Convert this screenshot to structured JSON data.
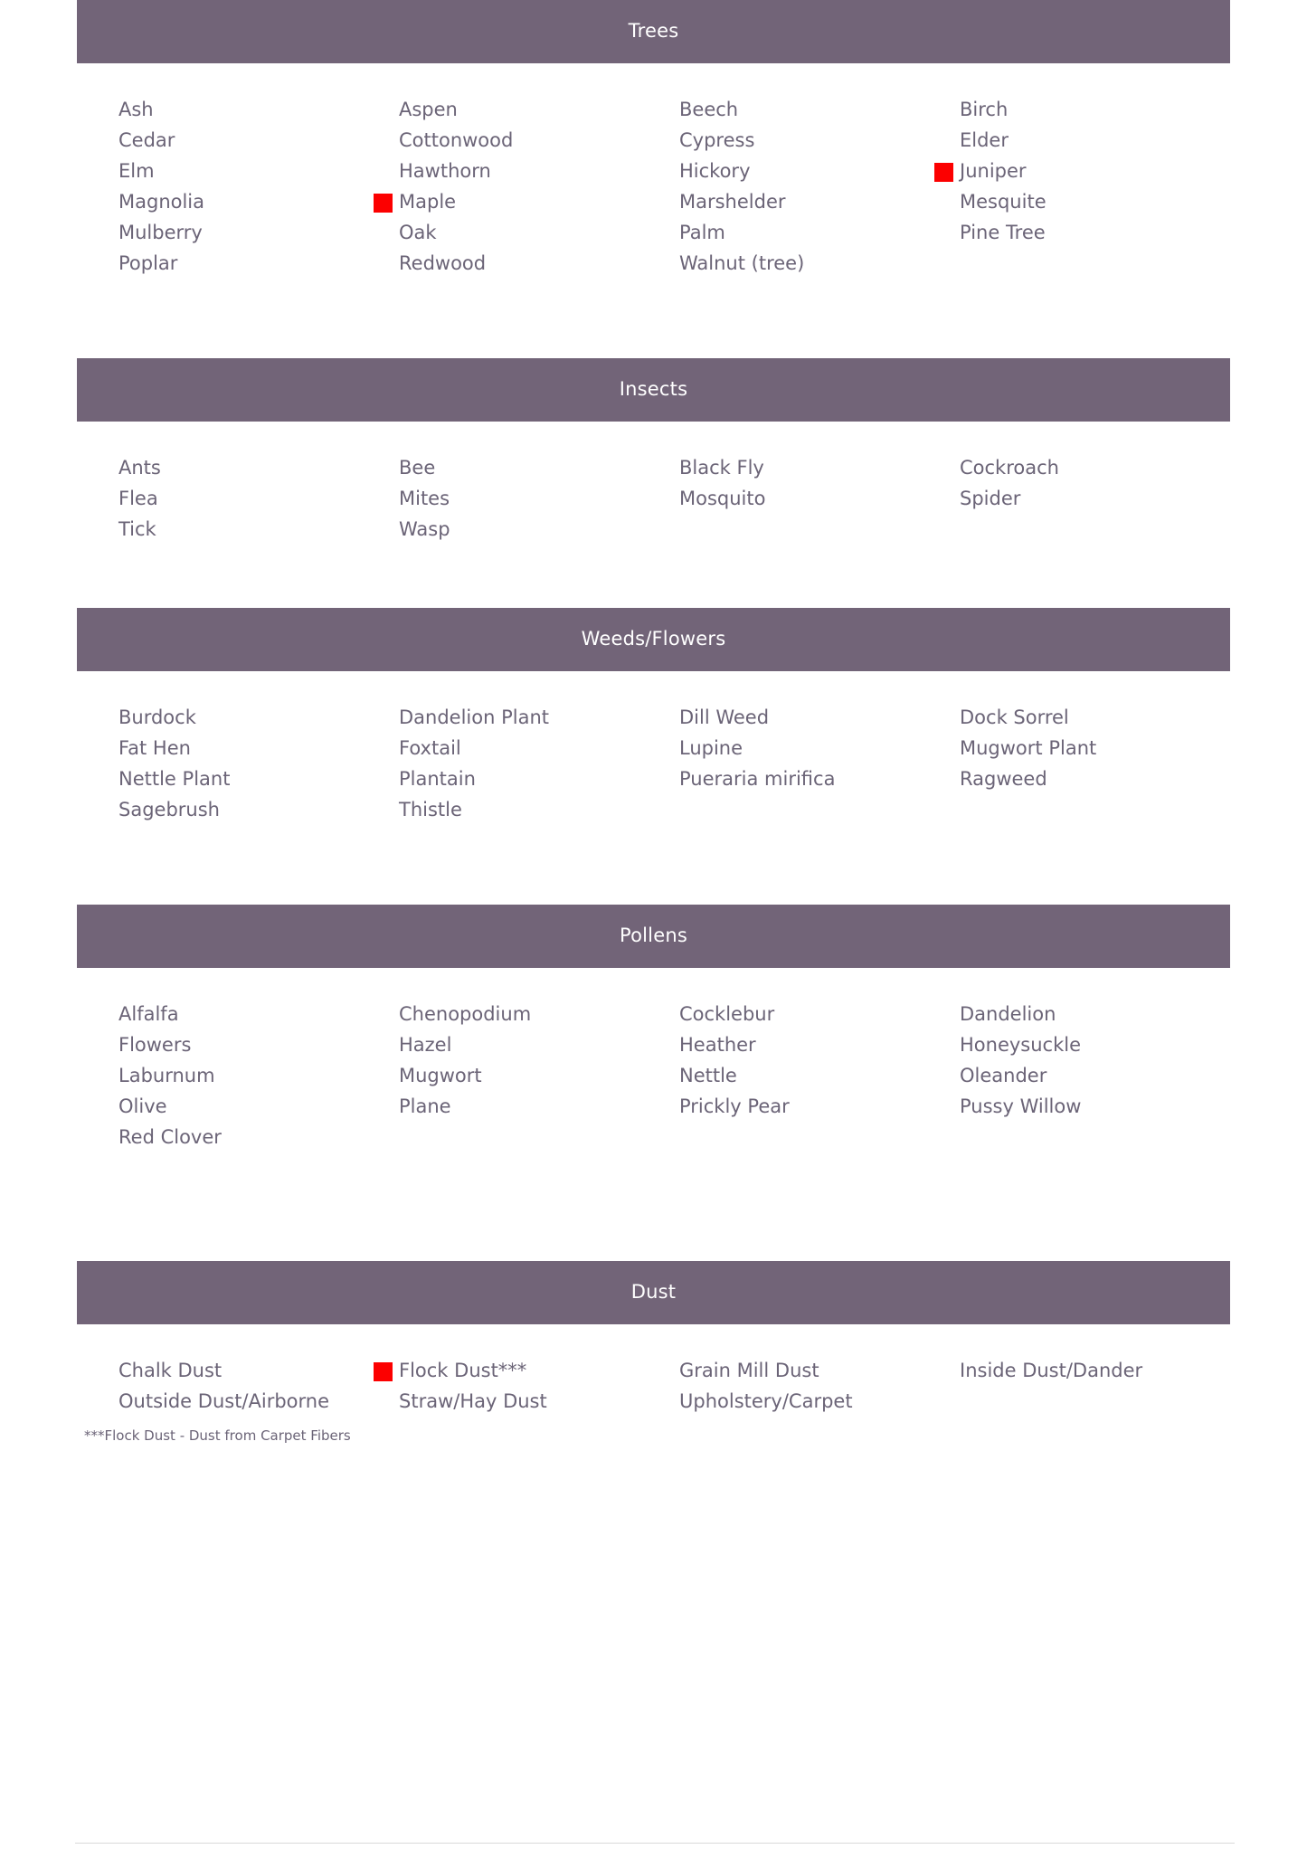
{
  "colors": {
    "header_bg": "#726478",
    "header_text": "#ffffff",
    "item_text": "#6b6477",
    "marker_red": "#fc0000",
    "page_bg": "#ffffff",
    "rule": "#d9d9d9"
  },
  "sections": [
    {
      "title": "Trees",
      "columns": [
        [
          {
            "label": "Ash",
            "marked": false
          },
          {
            "label": "Cedar",
            "marked": false
          },
          {
            "label": "Elm",
            "marked": false
          },
          {
            "label": "Magnolia",
            "marked": false
          },
          {
            "label": "Mulberry",
            "marked": false
          },
          {
            "label": "Poplar",
            "marked": false
          }
        ],
        [
          {
            "label": "Aspen",
            "marked": false
          },
          {
            "label": "Cottonwood",
            "marked": false
          },
          {
            "label": "Hawthorn",
            "marked": false
          },
          {
            "label": "Maple",
            "marked": true
          },
          {
            "label": "Oak",
            "marked": false
          },
          {
            "label": "Redwood",
            "marked": false
          }
        ],
        [
          {
            "label": "Beech",
            "marked": false
          },
          {
            "label": "Cypress",
            "marked": false
          },
          {
            "label": "Hickory",
            "marked": false
          },
          {
            "label": "Marshelder",
            "marked": false
          },
          {
            "label": "Palm",
            "marked": false
          },
          {
            "label": "Walnut (tree)",
            "marked": false
          }
        ],
        [
          {
            "label": "Birch",
            "marked": false
          },
          {
            "label": "Elder",
            "marked": false
          },
          {
            "label": "Juniper",
            "marked": true
          },
          {
            "label": "Mesquite",
            "marked": false
          },
          {
            "label": "Pine Tree",
            "marked": false
          }
        ]
      ],
      "footnote": "",
      "gap_after": "gap-md"
    },
    {
      "title": "Insects",
      "columns": [
        [
          {
            "label": "Ants",
            "marked": false
          },
          {
            "label": "Flea",
            "marked": false
          },
          {
            "label": "Tick",
            "marked": false
          }
        ],
        [
          {
            "label": "Bee",
            "marked": false
          },
          {
            "label": "Mites",
            "marked": false
          },
          {
            "label": "Wasp",
            "marked": false
          }
        ],
        [
          {
            "label": "Black Fly",
            "marked": false
          },
          {
            "label": "Mosquito",
            "marked": false
          }
        ],
        [
          {
            "label": "Cockroach",
            "marked": false
          },
          {
            "label": "Spider",
            "marked": false
          }
        ]
      ],
      "footnote": "",
      "gap_after": "gap-sm"
    },
    {
      "title": "Weeds/Flowers",
      "columns": [
        [
          {
            "label": "Burdock",
            "marked": false
          },
          {
            "label": "Fat Hen",
            "marked": false
          },
          {
            "label": "Nettle Plant",
            "marked": false
          },
          {
            "label": "Sagebrush",
            "marked": false
          }
        ],
        [
          {
            "label": "Dandelion Plant",
            "marked": false
          },
          {
            "label": "Foxtail",
            "marked": false
          },
          {
            "label": "Plantain",
            "marked": false
          },
          {
            "label": "Thistle",
            "marked": false
          }
        ],
        [
          {
            "label": "Dill Weed",
            "marked": false
          },
          {
            "label": "Lupine",
            "marked": false
          },
          {
            "label": "Pueraria mirifica",
            "marked": false
          }
        ],
        [
          {
            "label": "Dock Sorrel",
            "marked": false
          },
          {
            "label": "Mugwort Plant",
            "marked": false
          },
          {
            "label": "Ragweed",
            "marked": false
          }
        ]
      ],
      "footnote": "",
      "gap_after": "gap-md"
    },
    {
      "title": "Pollens",
      "columns": [
        [
          {
            "label": "Alfalfa",
            "marked": false
          },
          {
            "label": "Flowers",
            "marked": false
          },
          {
            "label": "Laburnum",
            "marked": false
          },
          {
            "label": "Olive",
            "marked": false
          },
          {
            "label": "Red Clover",
            "marked": false
          }
        ],
        [
          {
            "label": "Chenopodium",
            "marked": false
          },
          {
            "label": "Hazel",
            "marked": false
          },
          {
            "label": "Mugwort",
            "marked": false
          },
          {
            "label": "Plane",
            "marked": false
          }
        ],
        [
          {
            "label": "Cocklebur",
            "marked": false
          },
          {
            "label": "Heather",
            "marked": false
          },
          {
            "label": "Nettle",
            "marked": false
          },
          {
            "label": "Prickly Pear",
            "marked": false
          }
        ],
        [
          {
            "label": "Dandelion",
            "marked": false
          },
          {
            "label": "Honeysuckle",
            "marked": false
          },
          {
            "label": "Oleander",
            "marked": false
          },
          {
            "label": "Pussy Willow",
            "marked": false
          }
        ]
      ],
      "footnote": "",
      "gap_after": "gap-xl"
    },
    {
      "title": "Dust",
      "columns": [
        [
          {
            "label": "Chalk Dust",
            "marked": false
          },
          {
            "label": "Outside Dust/Airborne",
            "marked": false
          }
        ],
        [
          {
            "label": "Flock Dust***",
            "marked": true
          },
          {
            "label": "Straw/Hay Dust",
            "marked": false
          }
        ],
        [
          {
            "label": "Grain Mill Dust",
            "marked": false
          },
          {
            "label": "Upholstery/Carpet",
            "marked": false
          }
        ],
        [
          {
            "label": "Inside Dust/Dander",
            "marked": false
          }
        ]
      ],
      "footnote": "***Flock Dust - Dust from Carpet Fibers",
      "gap_after": "gap-sm"
    }
  ]
}
